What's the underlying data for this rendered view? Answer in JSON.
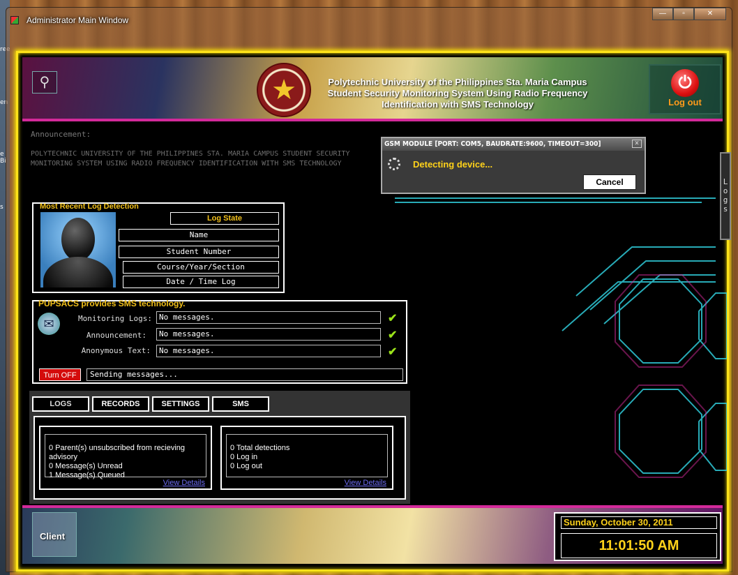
{
  "window": {
    "title": "Administrator Main Window",
    "minimize_label": "—",
    "maximize_label": "▫",
    "close_label": "✕"
  },
  "header": {
    "title_line1": "Polytechnic University of the Philippines Sta. Maria Campus",
    "title_line2": "Student Security Monitoring System Using Radio Frequency",
    "title_line3": "Identification with SMS Technology",
    "logout_label": "Log out"
  },
  "announcement": {
    "title": "Announcement:",
    "body": "POLYTECHNIC UNIVERSITY OF THE PHILIPPINES STA. MARIA CAMPUS STUDENT SECURITY MONITORING SYSTEM USING RADIO FREQUENCY IDENTIFICATION WITH SMS TECHNOLOGY"
  },
  "gsm_dialog": {
    "title": "GSM MODULE [PORT: COM5, BAUDRATE:9600, TIMEOUT=300]",
    "status": "Detecting device...",
    "cancel_label": "Cancel"
  },
  "logs_side_tab": "Logs",
  "recent_log": {
    "title": "Most Recent Log Detection",
    "log_state": "Log State",
    "name": "Name",
    "student_number": "Student Number",
    "course": "Course/Year/Section",
    "datetime": "Date / Time Log"
  },
  "sms": {
    "title": "PUPSACS provides SMS technology.",
    "monitoring_label": "Monitoring Logs:",
    "monitoring_value": "No messages.",
    "announcement_label": "Announcement:",
    "announcement_value": "No messages.",
    "anonymous_label": "Anonymous Text:",
    "anonymous_value": "No messages.",
    "turnoff_label": "Turn OFF",
    "sending_status": "Sending messages..."
  },
  "tabs": {
    "logs": "LOGS",
    "records": "RECORDS",
    "settings": "SETTINGS",
    "sms": "SMS"
  },
  "cards": {
    "left": {
      "line1": "0 Parent(s) unsubscribed from recieving advisory",
      "line2": "0 Message(s) Unread",
      "line3": "1 Message(s) Queued",
      "link": "View Details"
    },
    "right": {
      "line1": "0 Total detections",
      "line2": "0 Log in",
      "line3": "0 Log out",
      "link": "View Details"
    }
  },
  "footer": {
    "client_label": "Client",
    "date": "Sunday, October 30, 2011",
    "time": "11:01:50 AM"
  },
  "colors": {
    "accent_yellow": "#ffd21a",
    "frame_yellow": "#ffe31a",
    "circuit_cyan": "#2fc9d8",
    "magenta": "#d32a9a"
  }
}
